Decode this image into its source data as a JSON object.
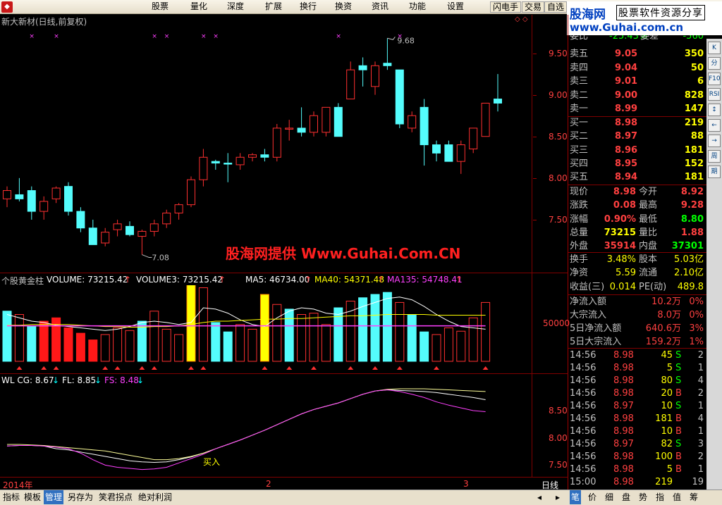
{
  "menubar": {
    "items": [
      "股票",
      "量化",
      "深度",
      "扩展",
      "换行",
      "换资",
      "资讯",
      "功能",
      "设置"
    ],
    "active": "股票",
    "buttons": [
      "闪电手",
      "交易",
      "自选"
    ]
  },
  "logo": {
    "name": "股海网",
    "slogan": "股票软件资源分享",
    "url": "www.Guhai.com.cn"
  },
  "chart": {
    "title": "新大新材(日线,前复权)",
    "price_ticks": [
      "9.50",
      "9.00",
      "8.50",
      "8.00",
      "7.50"
    ],
    "high_label": "9.68",
    "low_label": "7.08",
    "watermark": "股海网提供 Www.Guhai.Com.CN",
    "date_labels": [
      "2014年",
      "2",
      "3"
    ],
    "period": "日线"
  },
  "volume": {
    "title": "个股黄金柱",
    "legend": [
      {
        "text": "VOLUME: 73215.42",
        "color": "#ffffff"
      },
      {
        "text": "VOLUME3: 73215.42",
        "color": "#ffffff"
      },
      {
        "text": "MA5: 46734.00",
        "color": "#ffffff"
      },
      {
        "text": "MA40: 54371.48",
        "color": "#ffff00"
      },
      {
        "text": "MA135: 54748.41",
        "color": "#ff40ff"
      }
    ],
    "tick": "50000"
  },
  "indicator": {
    "legend": [
      {
        "text": "WL CG: 8.67",
        "color": "#ffffff"
      },
      {
        "text": "FL: 8.85",
        "color": "#ffffff"
      },
      {
        "text": "FS: 8.48",
        "color": "#ff40ff"
      }
    ],
    "ticks": [
      "8.50",
      "8.00",
      "7.50"
    ],
    "buy_label": "买入"
  },
  "chart_data": {
    "type": "candlestick",
    "candles": [
      {
        "o": 7.75,
        "h": 7.9,
        "l": 7.65,
        "c": 7.85
      },
      {
        "o": 7.8,
        "h": 8.0,
        "l": 7.72,
        "c": 7.75
      },
      {
        "o": 7.85,
        "h": 7.9,
        "l": 7.5,
        "c": 7.6
      },
      {
        "o": 7.6,
        "h": 7.78,
        "l": 7.5,
        "c": 7.72
      },
      {
        "o": 7.75,
        "h": 7.9,
        "l": 7.7,
        "c": 7.88
      },
      {
        "o": 7.9,
        "h": 7.95,
        "l": 7.55,
        "c": 7.6
      },
      {
        "o": 7.6,
        "h": 7.65,
        "l": 7.35,
        "c": 7.4
      },
      {
        "o": 7.4,
        "h": 7.5,
        "l": 7.2,
        "c": 7.2
      },
      {
        "o": 7.22,
        "h": 7.4,
        "l": 7.18,
        "c": 7.35
      },
      {
        "o": 7.38,
        "h": 7.5,
        "l": 7.3,
        "c": 7.45
      },
      {
        "o": 7.42,
        "h": 7.48,
        "l": 7.3,
        "c": 7.32
      },
      {
        "o": 7.3,
        "h": 7.38,
        "l": 7.08,
        "c": 7.36
      },
      {
        "o": 7.36,
        "h": 7.5,
        "l": 7.3,
        "c": 7.45
      },
      {
        "o": 7.45,
        "h": 7.62,
        "l": 7.4,
        "c": 7.58
      },
      {
        "o": 7.58,
        "h": 7.7,
        "l": 7.5,
        "c": 7.68
      },
      {
        "o": 7.68,
        "h": 8.02,
        "l": 7.65,
        "c": 7.98
      },
      {
        "o": 7.98,
        "h": 8.35,
        "l": 7.9,
        "c": 8.25
      },
      {
        "o": 8.2,
        "h": 8.22,
        "l": 8.1,
        "c": 8.18
      },
      {
        "o": 8.18,
        "h": 8.3,
        "l": 7.95,
        "c": 8.17
      },
      {
        "o": 8.16,
        "h": 8.3,
        "l": 8.1,
        "c": 8.25
      },
      {
        "o": 8.25,
        "h": 8.3,
        "l": 8.2,
        "c": 8.28
      },
      {
        "o": 8.28,
        "h": 8.35,
        "l": 8.2,
        "c": 8.25
      },
      {
        "o": 8.25,
        "h": 8.65,
        "l": 8.2,
        "c": 8.6
      },
      {
        "o": 8.6,
        "h": 8.7,
        "l": 8.45,
        "c": 8.6
      },
      {
        "o": 8.6,
        "h": 8.85,
        "l": 8.5,
        "c": 8.55
      },
      {
        "o": 8.55,
        "h": 8.8,
        "l": 8.5,
        "c": 8.75
      },
      {
        "o": 8.55,
        "h": 8.85,
        "l": 8.5,
        "c": 8.85
      },
      {
        "o": 8.85,
        "h": 8.9,
        "l": 8.5,
        "c": 8.5
      },
      {
        "o": 8.95,
        "h": 9.4,
        "l": 8.95,
        "c": 9.3
      },
      {
        "o": 9.35,
        "h": 9.45,
        "l": 9.1,
        "c": 9.3
      },
      {
        "o": 9.1,
        "h": 9.4,
        "l": 9.0,
        "c": 9.35
      },
      {
        "o": 9.38,
        "h": 9.68,
        "l": 9.3,
        "c": 9.35
      },
      {
        "o": 9.3,
        "h": 9.3,
        "l": 8.6,
        "c": 8.65
      },
      {
        "o": 8.6,
        "h": 8.8,
        "l": 8.55,
        "c": 8.75
      },
      {
        "o": 8.85,
        "h": 8.95,
        "l": 8.15,
        "c": 8.4
      },
      {
        "o": 8.4,
        "h": 8.45,
        "l": 8.2,
        "c": 8.3
      },
      {
        "o": 8.4,
        "h": 8.45,
        "l": 8.2,
        "c": 8.2
      },
      {
        "o": 8.2,
        "h": 8.45,
        "l": 8.05,
        "c": 8.4
      },
      {
        "o": 8.35,
        "h": 8.6,
        "l": 8.3,
        "c": 8.6
      },
      {
        "o": 8.5,
        "h": 8.9,
        "l": 8.5,
        "c": 8.9
      },
      {
        "o": 8.95,
        "h": 9.25,
        "l": 8.8,
        "c": 8.9
      }
    ],
    "volumes": [
      {
        "v": 75,
        "t": "cyan"
      },
      {
        "v": 70,
        "t": "redhollow"
      },
      {
        "v": 52,
        "t": "cyan"
      },
      {
        "v": 60,
        "t": "redfill"
      },
      {
        "v": 65,
        "t": "redfill"
      },
      {
        "v": 50,
        "t": "redfill"
      },
      {
        "v": 42,
        "t": "redfill"
      },
      {
        "v": 32,
        "t": "redfill"
      },
      {
        "v": 40,
        "t": "redhollow"
      },
      {
        "v": 50,
        "t": "redhollow"
      },
      {
        "v": 46,
        "t": "redhollow"
      },
      {
        "v": 60,
        "t": "cyan"
      },
      {
        "v": 75,
        "t": "redhollow"
      },
      {
        "v": 48,
        "t": "redhollow"
      },
      {
        "v": 40,
        "t": "redhollow"
      },
      {
        "v": 120,
        "t": "yellow"
      },
      {
        "v": 110,
        "t": "redhollow"
      },
      {
        "v": 58,
        "t": "cyan"
      },
      {
        "v": 44,
        "t": "cyan"
      },
      {
        "v": 55,
        "t": "redhollow"
      },
      {
        "v": 48,
        "t": "redhollow"
      },
      {
        "v": 100,
        "t": "yellow"
      },
      {
        "v": 85,
        "t": "redhollow"
      },
      {
        "v": 78,
        "t": "cyan"
      },
      {
        "v": 70,
        "t": "redhollow"
      },
      {
        "v": 72,
        "t": "redhollow"
      },
      {
        "v": 55,
        "t": "redhollow"
      },
      {
        "v": 80,
        "t": "cyan"
      },
      {
        "v": 90,
        "t": "redhollow"
      },
      {
        "v": 95,
        "t": "cyan"
      },
      {
        "v": 100,
        "t": "cyan"
      },
      {
        "v": 103,
        "t": "cyan"
      },
      {
        "v": 88,
        "t": "redhollow"
      },
      {
        "v": 70,
        "t": "cyan"
      },
      {
        "v": 44,
        "t": "cyan"
      },
      {
        "v": 40,
        "t": "redhollow"
      },
      {
        "v": 50,
        "t": "redhollow"
      },
      {
        "v": 45,
        "t": "redhollow"
      },
      {
        "v": 65,
        "t": "redhollow"
      },
      {
        "v": 88,
        "t": "redhollow"
      }
    ]
  },
  "quote": {
    "top_partial": {
      "l1": "委比",
      "v1": "-25.43%",
      "l2": "委差",
      "v2": "-560"
    },
    "sell": [
      {
        "label": "卖五",
        "price": "9.05",
        "vol": "350"
      },
      {
        "label": "卖四",
        "price": "9.04",
        "vol": "50"
      },
      {
        "label": "卖三",
        "price": "9.01",
        "vol": "6"
      },
      {
        "label": "卖二",
        "price": "9.00",
        "vol": "828"
      },
      {
        "label": "卖一",
        "price": "8.99",
        "vol": "147"
      }
    ],
    "buy": [
      {
        "label": "买一",
        "price": "8.98",
        "vol": "219"
      },
      {
        "label": "买二",
        "price": "8.97",
        "vol": "88"
      },
      {
        "label": "买三",
        "price": "8.96",
        "vol": "181"
      },
      {
        "label": "买四",
        "price": "8.95",
        "vol": "152"
      },
      {
        "label": "买五",
        "price": "8.94",
        "vol": "181"
      }
    ],
    "stats": [
      {
        "l1": "现价",
        "v1": "8.98",
        "c1": "#ff4040",
        "l2": "今开",
        "v2": "8.92",
        "c2": "#ff4040"
      },
      {
        "l1": "涨跌",
        "v1": "0.08",
        "c1": "#ff4040",
        "l2": "最高",
        "v2": "9.28",
        "c2": "#ff4040"
      },
      {
        "l1": "涨幅",
        "v1": "0.90%",
        "c1": "#ff4040",
        "l2": "最低",
        "v2": "8.80",
        "c2": "#00ff00"
      },
      {
        "l1": "总量",
        "v1": "73215",
        "c1": "#ffff00",
        "l2": "量比",
        "v2": "1.88",
        "c2": "#ff4040"
      },
      {
        "l1": "外盘",
        "v1": "35914",
        "c1": "#ff4040",
        "l2": "内盘",
        "v2": "37301",
        "c2": "#00ff00"
      }
    ],
    "stats2": [
      {
        "l1": "换手",
        "v1": "3.48%",
        "l2": "股本",
        "v2": "5.03亿"
      },
      {
        "l1": "净资",
        "v1": "5.59",
        "l2": "流通",
        "v2": "2.10亿"
      },
      {
        "l1": "收益(三)",
        "v1": "0.014",
        "l2": "PE(动)",
        "v2": "489.8"
      }
    ],
    "flows": [
      {
        "label": "净流入额",
        "value": "10.2万",
        "pct": "0%"
      },
      {
        "label": "大宗流入",
        "value": "8.0万",
        "pct": "0%"
      },
      {
        "label": "5日净流入额",
        "value": "640.6万",
        "pct": "3%"
      },
      {
        "label": "5日大宗流入",
        "value": "159.2万",
        "pct": "1%"
      }
    ],
    "ticks": [
      {
        "time": "14:56",
        "price": "8.98",
        "vol": "45",
        "side": "S",
        "n": "2"
      },
      {
        "time": "14:56",
        "price": "8.98",
        "vol": "5",
        "side": "S",
        "n": "1"
      },
      {
        "time": "14:56",
        "price": "8.98",
        "vol": "80",
        "side": "S",
        "n": "4"
      },
      {
        "time": "14:56",
        "price": "8.98",
        "vol": "20",
        "side": "B",
        "n": "2"
      },
      {
        "time": "14:56",
        "price": "8.97",
        "vol": "10",
        "side": "S",
        "n": "1"
      },
      {
        "time": "14:56",
        "price": "8.98",
        "vol": "181",
        "side": "B",
        "n": "4"
      },
      {
        "time": "14:56",
        "price": "8.98",
        "vol": "10",
        "side": "B",
        "n": "1"
      },
      {
        "time": "14:56",
        "price": "8.97",
        "vol": "82",
        "side": "S",
        "n": "3"
      },
      {
        "time": "14:56",
        "price": "8.98",
        "vol": "100",
        "side": "B",
        "n": "2"
      },
      {
        "time": "14:56",
        "price": "8.98",
        "vol": "5",
        "side": "B",
        "n": "1"
      },
      {
        "time": "15:00",
        "price": "8.98",
        "vol": "219",
        "side": "",
        "n": "19"
      }
    ]
  },
  "bottom": {
    "tabs": [
      "指标",
      "模板",
      "管理",
      "另存为",
      "笑君拐点",
      "绝对利润"
    ],
    "selected": "管理",
    "right_tabs": [
      "笔",
      "价",
      "细",
      "盘",
      "势",
      "指",
      "值",
      "筹"
    ]
  },
  "side_icons": [
    "K",
    "分",
    "F10",
    "RSI",
    "↕",
    "←",
    "→",
    "周",
    "期"
  ]
}
